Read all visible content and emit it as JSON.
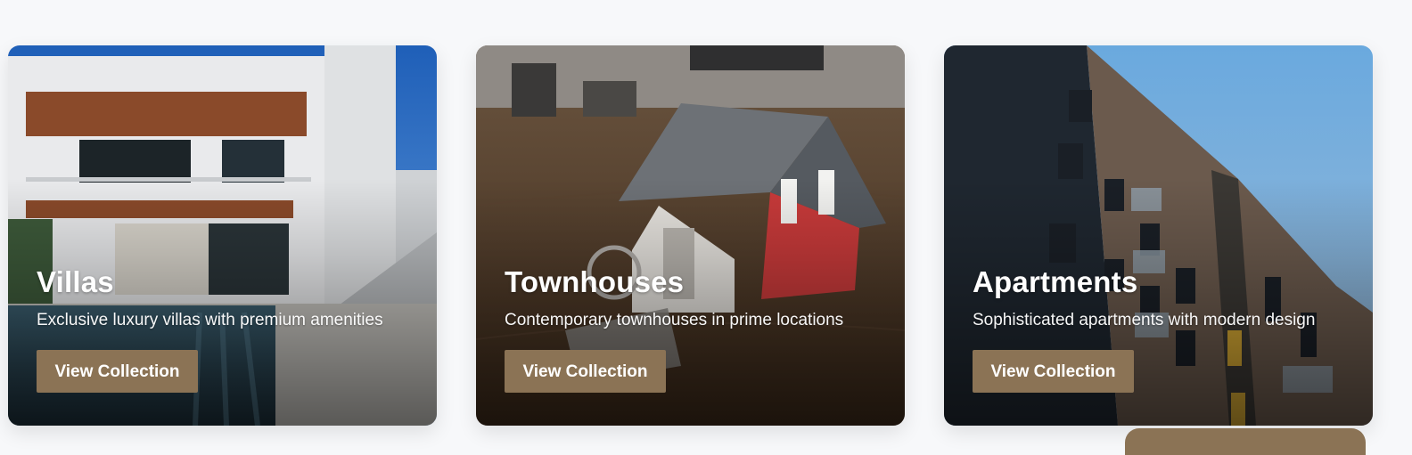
{
  "accent_color": "#8b7355",
  "collections": [
    {
      "title": "Villas",
      "description": "Exclusive luxury villas with premium amenities",
      "button_label": "View Collection",
      "image": "modern-villa-with-pool"
    },
    {
      "title": "Townhouses",
      "description": "Contemporary townhouses in prime locations",
      "button_label": "View Collection",
      "image": "model-house-with-keys"
    },
    {
      "title": "Apartments",
      "description": "Sophisticated apartments with modern design",
      "button_label": "View Collection",
      "image": "apartment-building-facade"
    }
  ]
}
